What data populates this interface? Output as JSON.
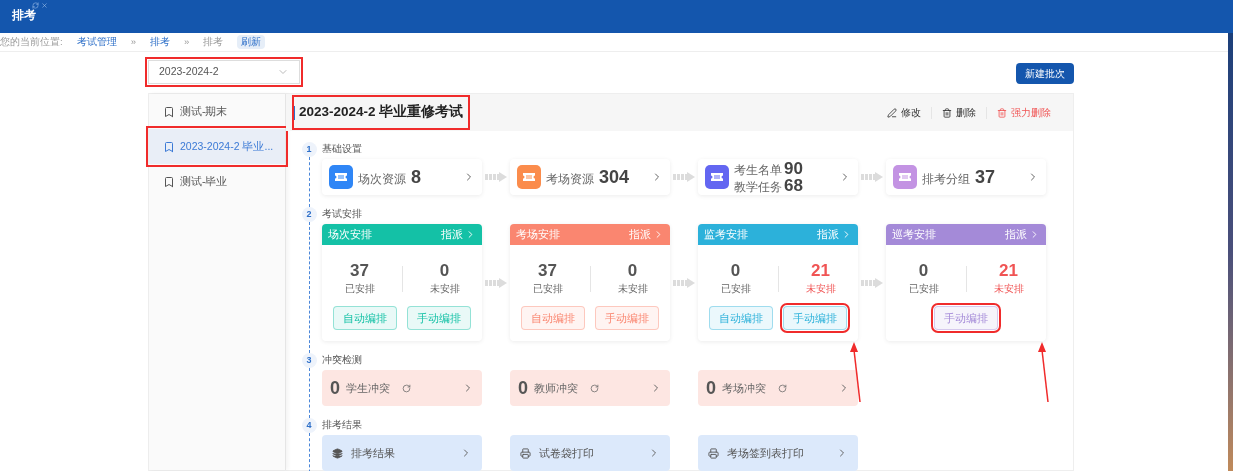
{
  "window": {
    "title": "排考"
  },
  "breadcrumb": {
    "label": "您的当前位置:",
    "items": [
      {
        "text": "考试管理",
        "kind": "link"
      },
      {
        "text": "排考",
        "kind": "link"
      },
      {
        "text": "排考",
        "kind": "current"
      }
    ],
    "separator": "»",
    "refresh": "刷新"
  },
  "term_select": {
    "value": "2023-2024-2",
    "highlighted": true
  },
  "new_button": "新建批次",
  "sidebar": {
    "items": [
      {
        "label": "测试-期末",
        "selected": false,
        "highlighted": false
      },
      {
        "label": "2023-2024-2 毕业...",
        "selected": true,
        "highlighted": true
      },
      {
        "label": "测试-毕业",
        "selected": false,
        "highlighted": false
      }
    ]
  },
  "header": {
    "title": "2023-2024-2 毕业重修考试",
    "highlighted": true,
    "actions": [
      {
        "label": "修改",
        "kind": "edit"
      },
      {
        "label": "删除",
        "kind": "delete"
      },
      {
        "label": "强力删除",
        "kind": "force-delete"
      }
    ]
  },
  "steps": [
    {
      "number": "1",
      "title": "基础设置",
      "kind": "resources",
      "items": [
        {
          "color": "#2f86f6",
          "lines": [
            {
              "label": "场次资源",
              "value": "8"
            }
          ]
        },
        {
          "color": "#fb8c4c",
          "lines": [
            {
              "label": "考场资源",
              "value": "304"
            }
          ]
        },
        {
          "color": "#6366f1",
          "lines": [
            {
              "label": "考生名单",
              "value": "90"
            },
            {
              "label": "教学任务",
              "value": "68"
            }
          ]
        },
        {
          "color": "#c393e3",
          "lines": [
            {
              "label": "排考分组",
              "value": "37"
            }
          ]
        }
      ]
    },
    {
      "number": "2",
      "title": "考试安排",
      "kind": "arrangements",
      "items": [
        {
          "title": "场次安排",
          "action": "指派",
          "color": "#14c1a6",
          "done": "37",
          "done_label": "已安排",
          "pending": "0",
          "pending_label": "未安排",
          "alert": false,
          "arrow": false,
          "buttons": [
            {
              "label": "自动编排",
              "highlighted": false
            },
            {
              "label": "手动编排",
              "highlighted": false
            }
          ]
        },
        {
          "title": "考场安排",
          "action": "指派",
          "color": "#fa8670",
          "done": "37",
          "done_label": "已安排",
          "pending": "0",
          "pending_label": "未安排",
          "alert": false,
          "arrow": false,
          "buttons": [
            {
              "label": "自动编排",
              "highlighted": false
            },
            {
              "label": "手动编排",
              "highlighted": false
            }
          ]
        },
        {
          "title": "监考安排",
          "action": "指派",
          "color": "#2cb1da",
          "done": "0",
          "done_label": "已安排",
          "pending": "21",
          "pending_label": "未安排",
          "alert": true,
          "arrow": true,
          "buttons": [
            {
              "label": "自动编排",
              "highlighted": false
            },
            {
              "label": "手动编排",
              "highlighted": true
            }
          ]
        },
        {
          "title": "巡考安排",
          "action": "指派",
          "color": "#a48ad8",
          "done": "0",
          "done_label": "已安排",
          "pending": "21",
          "pending_label": "未安排",
          "alert": true,
          "arrow": true,
          "buttons": [
            {
              "label": "手动编排",
              "highlighted": true
            }
          ]
        }
      ]
    },
    {
      "number": "3",
      "title": "冲突检测",
      "kind": "conflicts",
      "items": [
        {
          "count": "0",
          "label": "学生冲突"
        },
        {
          "count": "0",
          "label": "教师冲突"
        },
        {
          "count": "0",
          "label": "考场冲突"
        }
      ]
    },
    {
      "number": "4",
      "title": "排考结果",
      "kind": "results",
      "items": [
        {
          "label": "排考结果"
        },
        {
          "label": "试卷袋打印"
        },
        {
          "label": "考场签到表打印"
        }
      ]
    }
  ]
}
